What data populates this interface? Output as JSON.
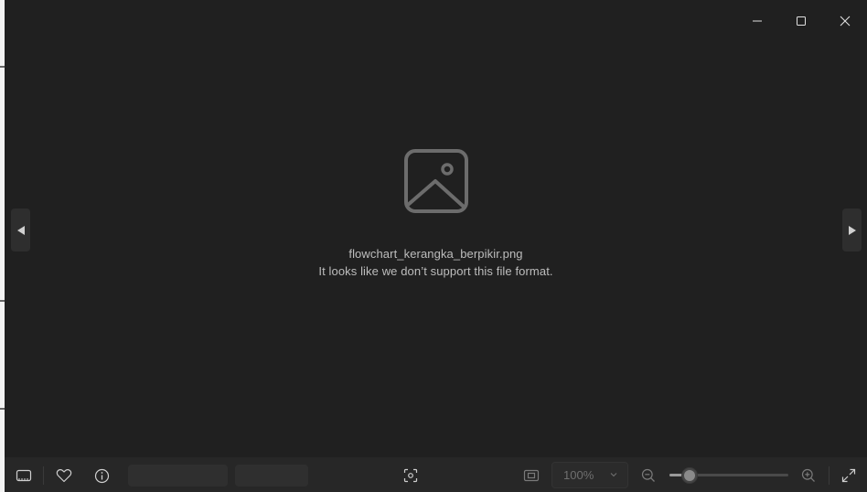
{
  "window": {
    "controls": [
      {
        "name": "minimize-button",
        "icon": "minimize-icon"
      },
      {
        "name": "maximize-button",
        "icon": "maximize-icon"
      },
      {
        "name": "close-button",
        "icon": "close-icon"
      }
    ]
  },
  "viewer": {
    "placeholder_icon": "image-icon",
    "file_name": "flowchart_kerangka_berpikir.png",
    "error_message": "It looks like we don’t support this file format.",
    "prev_icon": "triangle-left-icon",
    "next_icon": "triangle-right-icon"
  },
  "toolbar": {
    "filmstrip_icon": "filmstrip-icon",
    "favorite_icon": "heart-icon",
    "info_icon": "info-icon",
    "focus_icon": "scan-icon",
    "actual_size_icon": "actual-size-icon",
    "zoom_value": "100%",
    "zoom_out_icon": "zoom-out-icon",
    "zoom_in_icon": "zoom-in-icon",
    "zoom_slider_level": 0.17,
    "fullscreen_icon": "expand-icon"
  },
  "colors": {
    "background": "#202020",
    "toolbar": "#272727",
    "text": "#bdbdbd",
    "icon": "#cfcfcf"
  }
}
